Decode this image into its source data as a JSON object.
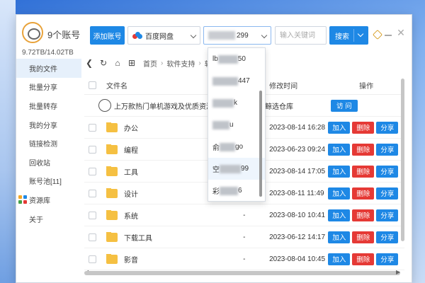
{
  "header": {
    "account_title": "9个账号",
    "storage": "9.72TB/14.02TB",
    "add_account_label": "添加账号",
    "drive_select_value": "百度网盘",
    "account_select_suffix": "299",
    "search_placeholder": "输入关键词",
    "search_label": "搜索"
  },
  "sidebar": {
    "items": [
      {
        "label": "我的文件"
      },
      {
        "label": "批量分享"
      },
      {
        "label": "批量转存"
      },
      {
        "label": "我的分享"
      },
      {
        "label": "链接检测"
      },
      {
        "label": "回收站"
      },
      {
        "label": "账号池[11]"
      },
      {
        "label": "资源库"
      },
      {
        "label": "关于"
      }
    ]
  },
  "nav": {
    "breadcrumbs": [
      "首页",
      "软件支持",
      "软"
    ]
  },
  "table": {
    "headers": {
      "name": "文件名",
      "time": "修改时间",
      "ops": "操作"
    },
    "resource_row": {
      "name": "上万款热门单机游戏及优质资源",
      "time": "鲸选仓库",
      "visit_label": "访 问"
    },
    "rows": [
      {
        "name": "办公",
        "size": "",
        "time": "2023-08-14 16:28"
      },
      {
        "name": "编程",
        "size": "",
        "time": "2023-06-23 09:24"
      },
      {
        "name": "工具",
        "size": "",
        "time": "2023-08-14 17:05"
      },
      {
        "name": "设计",
        "size": "-",
        "time": "2023-08-11 11:49"
      },
      {
        "name": "系统",
        "size": "-",
        "time": "2023-08-10 10:41"
      },
      {
        "name": "下载工具",
        "size": "-",
        "time": "2023-06-12 14:17"
      },
      {
        "name": "影音",
        "size": "-",
        "time": "2023-08-04 10:45"
      }
    ],
    "op_labels": {
      "add": "加入",
      "delete": "删除",
      "share": "分享"
    }
  },
  "dropdown": {
    "items": [
      {
        "prefix": "lb",
        "suffix": "50"
      },
      {
        "prefix": "",
        "suffix": "447"
      },
      {
        "prefix": "",
        "suffix": "k"
      },
      {
        "prefix": "",
        "suffix": "u"
      },
      {
        "prefix": "俞",
        "suffix": "go"
      },
      {
        "prefix": "空",
        "suffix": "99"
      },
      {
        "prefix": "彩",
        "suffix": "6"
      }
    ],
    "selected_index": 5
  },
  "colors": {
    "accent": "#1e88e5",
    "danger": "#e53935",
    "folder": "#f5c042"
  }
}
